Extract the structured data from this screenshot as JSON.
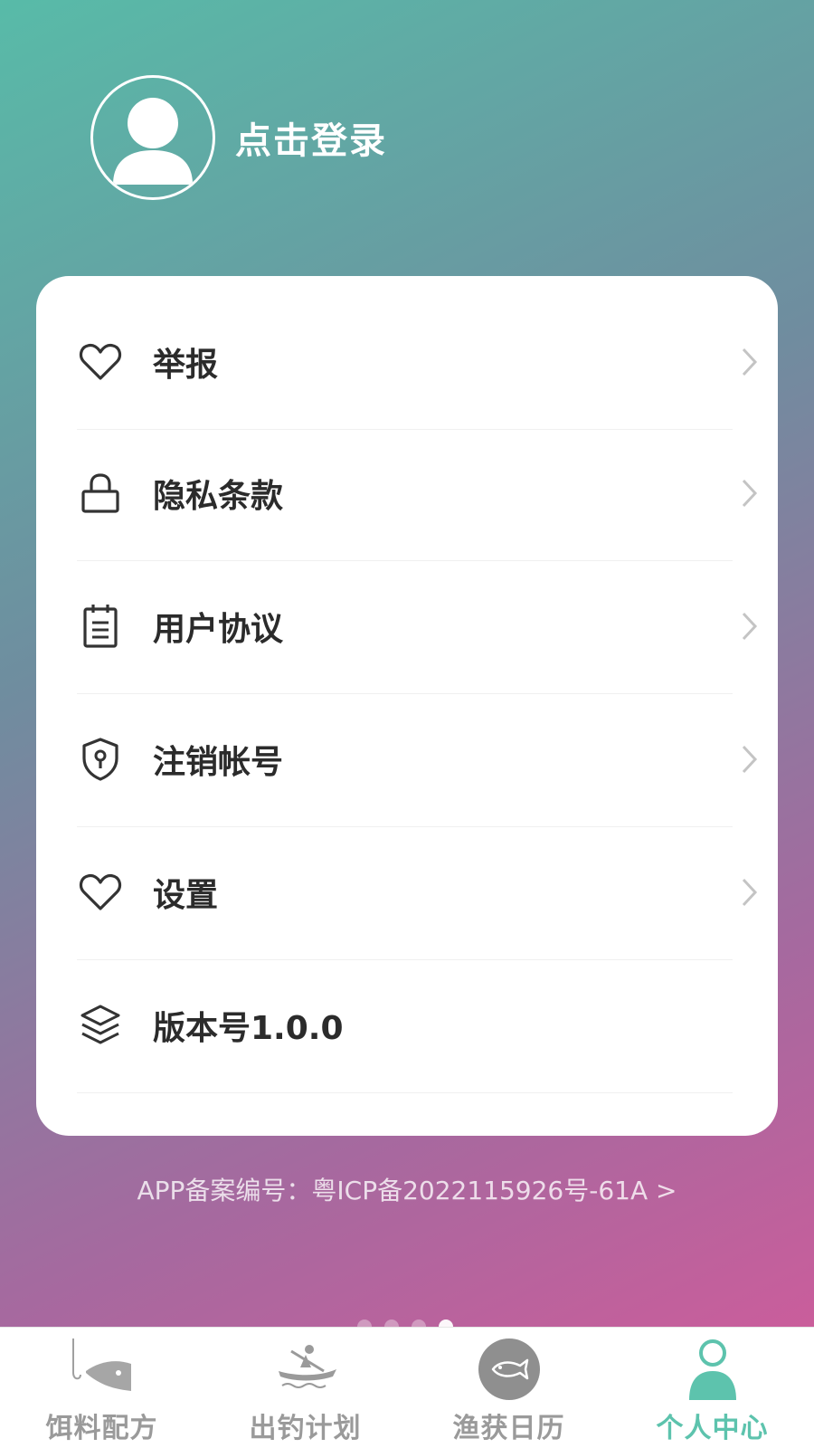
{
  "header": {
    "login_label": "点击登录"
  },
  "menu": {
    "items": [
      {
        "label": "举报",
        "icon": "heart-icon",
        "chevron": true
      },
      {
        "label": "隐私条款",
        "icon": "lock-icon",
        "chevron": true
      },
      {
        "label": "用户协议",
        "icon": "document-icon",
        "chevron": true
      },
      {
        "label": "注销帐号",
        "icon": "shield-icon",
        "chevron": true
      },
      {
        "label": "设置",
        "icon": "heart-icon",
        "chevron": true
      },
      {
        "label": "版本号1.0.0",
        "icon": "layers-icon",
        "chevron": false
      }
    ]
  },
  "footer": {
    "icp_text": "APP备案编号：粤ICP备2022115926号-61A >"
  },
  "pager": {
    "count": 4,
    "active_index": 3
  },
  "tabbar": {
    "tabs": [
      {
        "label": "饵料配方",
        "icon": "fishing-hook-icon",
        "active": false
      },
      {
        "label": "出钓计划",
        "icon": "kayak-icon",
        "active": false
      },
      {
        "label": "渔获日历",
        "icon": "fish-icon",
        "active": false
      },
      {
        "label": "个人中心",
        "icon": "person-icon",
        "active": true
      }
    ]
  },
  "colors": {
    "gradient_start": "#58bba8",
    "gradient_end": "#d55a9a",
    "accent": "#5dc3ad",
    "tab_inactive": "#9a9a9a"
  }
}
